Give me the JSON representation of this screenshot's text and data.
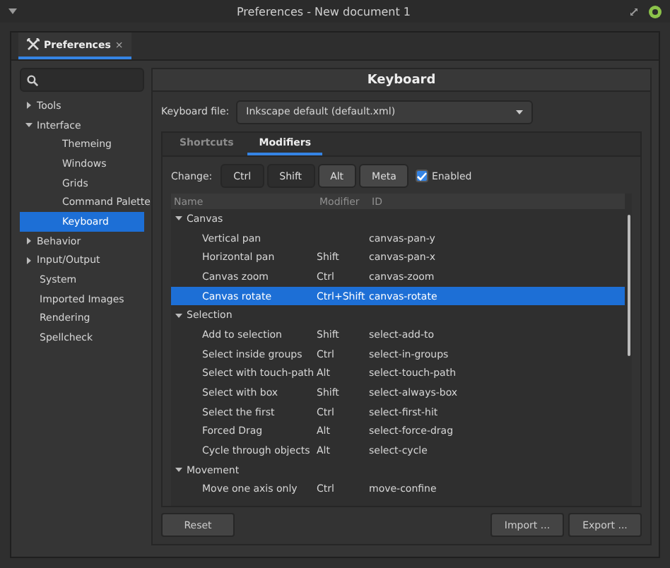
{
  "window": {
    "title": "Preferences - New document 1"
  },
  "doc_tab": {
    "label": "Preferences",
    "close": "×"
  },
  "sidebar": {
    "items": [
      {
        "label": "Tools",
        "expanded": false,
        "selected": false
      },
      {
        "label": "Interface",
        "expanded": true,
        "selected": false,
        "children": [
          {
            "label": "Themeing",
            "selected": false
          },
          {
            "label": "Windows",
            "selected": false
          },
          {
            "label": "Grids",
            "selected": false
          },
          {
            "label": "Command Palette",
            "selected": false
          },
          {
            "label": "Keyboard",
            "selected": true
          }
        ]
      },
      {
        "label": "Behavior",
        "expanded": false,
        "selected": false
      },
      {
        "label": "Input/Output",
        "expanded": false,
        "selected": false
      },
      {
        "label": "System",
        "selected": false
      },
      {
        "label": "Imported Images",
        "selected": false
      },
      {
        "label": "Rendering",
        "selected": false
      },
      {
        "label": "Spellcheck",
        "selected": false
      }
    ]
  },
  "page_title": "Keyboard",
  "keyboard_file": {
    "label": "Keyboard file:",
    "value": "Inkscape default (default.xml)"
  },
  "tabs": [
    {
      "label": "Shortcuts",
      "selected": false
    },
    {
      "label": "Modifiers",
      "selected": true
    }
  ],
  "change": {
    "label": "Change:",
    "buttons": [
      {
        "label": "Ctrl",
        "active": true
      },
      {
        "label": "Shift",
        "active": true
      },
      {
        "label": "Alt",
        "active": false
      },
      {
        "label": "Meta",
        "active": false
      }
    ],
    "enabled": {
      "label": "Enabled",
      "checked": true
    }
  },
  "table": {
    "columns": [
      "Name",
      "Modifier",
      "ID"
    ],
    "groups": [
      {
        "name": "Canvas",
        "expanded": true,
        "rows": [
          {
            "name": "Vertical pan",
            "modifier": "",
            "id": "canvas-pan-y",
            "selected": false
          },
          {
            "name": "Horizontal pan",
            "modifier": "Shift",
            "id": "canvas-pan-x",
            "selected": false
          },
          {
            "name": "Canvas zoom",
            "modifier": "Ctrl",
            "id": "canvas-zoom",
            "selected": false
          },
          {
            "name": "Canvas rotate",
            "modifier": "Ctrl+Shift",
            "id": "canvas-rotate",
            "selected": true
          }
        ]
      },
      {
        "name": "Selection",
        "expanded": true,
        "rows": [
          {
            "name": "Add to selection",
            "modifier": "Shift",
            "id": "select-add-to",
            "selected": false
          },
          {
            "name": "Select inside groups",
            "modifier": "Ctrl",
            "id": "select-in-groups",
            "selected": false
          },
          {
            "name": "Select with touch-path",
            "modifier": "Alt",
            "id": "select-touch-path",
            "selected": false
          },
          {
            "name": "Select with box",
            "modifier": "Shift",
            "id": "select-always-box",
            "selected": false
          },
          {
            "name": "Select the first",
            "modifier": "Ctrl",
            "id": "select-first-hit",
            "selected": false
          },
          {
            "name": "Forced Drag",
            "modifier": "Alt",
            "id": "select-force-drag",
            "selected": false
          },
          {
            "name": "Cycle through objects",
            "modifier": "Alt",
            "id": "select-cycle",
            "selected": false
          }
        ]
      },
      {
        "name": "Movement",
        "expanded": true,
        "rows": [
          {
            "name": "Move one axis only",
            "modifier": "Ctrl",
            "id": "move-confine",
            "selected": false
          }
        ]
      }
    ]
  },
  "buttons": {
    "reset": "Reset",
    "import": "Import ...",
    "export": "Export ..."
  }
}
